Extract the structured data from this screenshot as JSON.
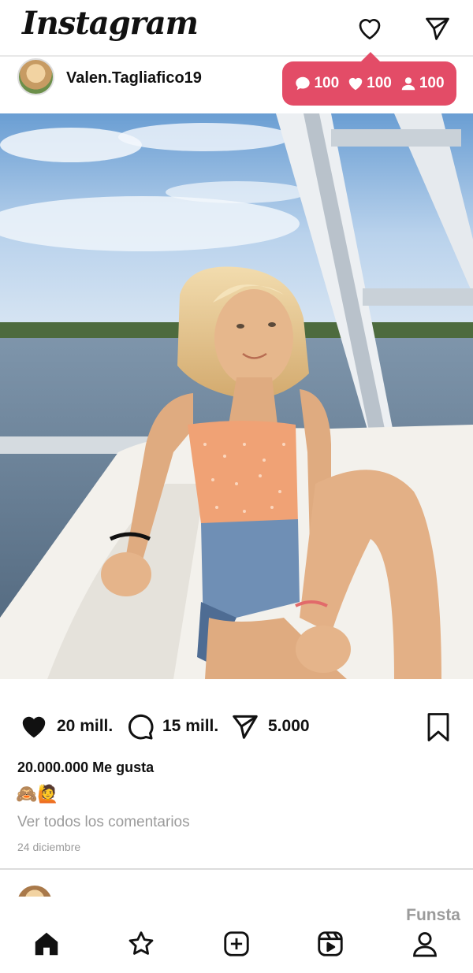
{
  "app": {
    "logo": "Instagram"
  },
  "notifications": {
    "comments": "100",
    "likes": "100",
    "followers": "100",
    "color": "#e34c67"
  },
  "post": {
    "username": "Valen.Tagliafico19",
    "likes_count": "20 mill.",
    "comments_count": "15 mill.",
    "shares_count": "5.000",
    "likes_text": "20.000.000 Me gusta",
    "caption_emojis": "🙈🙋",
    "view_comments": "Ver todos los comentarios",
    "date": "24 diciembre"
  },
  "bottom_nav": {
    "label": "Funsta",
    "items": [
      "home-icon",
      "star-icon",
      "add-post-icon",
      "reels-icon",
      "profile-icon"
    ]
  },
  "icons": [
    "heart-icon",
    "send-icon",
    "comment-icon",
    "bookmark-icon"
  ]
}
